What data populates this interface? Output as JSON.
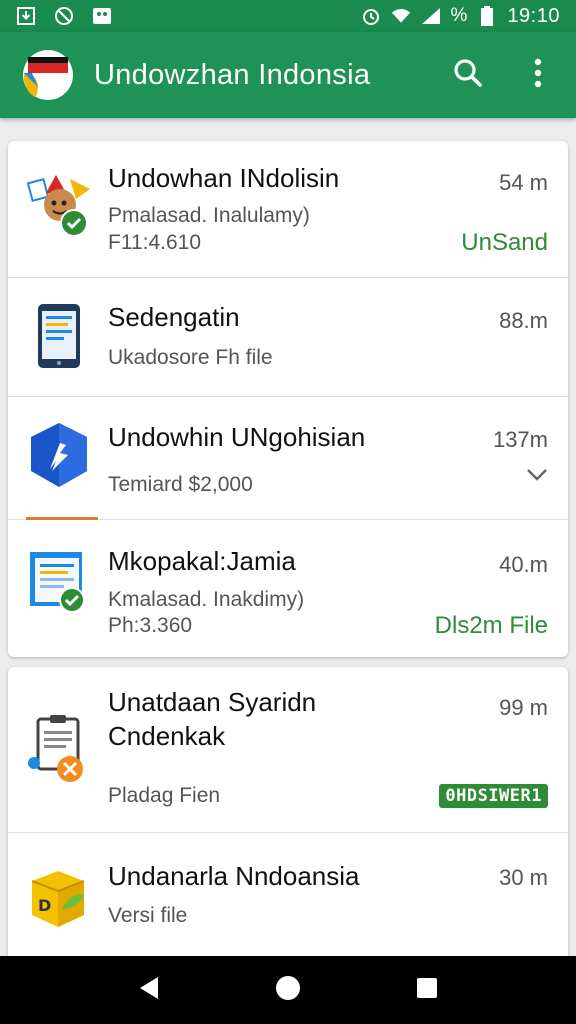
{
  "status_bar": {
    "left_icons": [
      "download-notification-icon",
      "no-signal-icon",
      "photo-notification-icon"
    ],
    "right_icons": [
      "alarm-icon",
      "wifi-icon",
      "cell-signal-icon",
      "battery-icon"
    ],
    "battery_text": "%",
    "time": "19:10"
  },
  "app_bar": {
    "title": "Undowzhan Indonsia",
    "logo": "app-logo-icon",
    "actions": [
      "search-icon",
      "more-vert-icon"
    ]
  },
  "colors": {
    "primary": "#1e9257",
    "status_bar": "#1a8a4e",
    "success": "#2e8b36",
    "accent": "#e07b39"
  },
  "items": [
    {
      "title": "Undowhan INdolisin",
      "subtitle": "Pmalasad. Inalulamy)",
      "meta": "F11:4.610",
      "size": "54 m",
      "status": "UnSand",
      "icon": "colorful-app-icon"
    },
    {
      "title": "Sedengatin",
      "subtitle": "Ukadosore Fh file",
      "size": "88.m",
      "icon": "tablet-document-icon"
    },
    {
      "title": "Undowhin UNgohisian",
      "subtitle": "Temiard $2,000",
      "size": "137m",
      "icon": "blue-hexagon-app-icon",
      "expand": "chevron-down-icon"
    },
    {
      "title": "Mkopakal:Jamia",
      "subtitle": "Kmalasad. Inakdimy)",
      "meta": "Ph:3.360",
      "size": "40.m",
      "status": "Dls2m File",
      "icon": "document-window-icon"
    },
    {
      "title": "Unatdaan Syaridn",
      "title2": "Cndenkak",
      "subtitle": "Pladag Fien",
      "size": "99 m",
      "badge": "0HDSIWER1",
      "icon": "clipboard-document-icon"
    },
    {
      "title": "Undanarla Nndoansia",
      "subtitle": "Versi file",
      "size": "30 m",
      "icon": "yellow-box-icon"
    }
  ],
  "nav_bar": {
    "buttons": [
      "back-icon",
      "home-icon",
      "recents-icon"
    ]
  }
}
